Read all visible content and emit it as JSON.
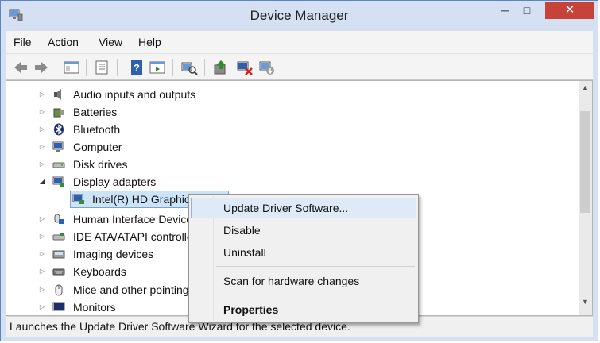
{
  "window": {
    "title": "Device Manager",
    "controls": {
      "minimize": "─",
      "maximize": "□",
      "close": "✕"
    }
  },
  "menubar": {
    "items": [
      "File",
      "Action",
      "View",
      "Help"
    ]
  },
  "toolbar": {
    "icons": [
      "back-arrow-icon",
      "forward-arrow-icon",
      "show-hide-console-tree-icon",
      "properties-icon",
      "help-icon",
      "action-pane-icon",
      "scan-hardware-icon",
      "update-driver-icon",
      "disable-device-icon",
      "uninstall-device-icon"
    ]
  },
  "tree": {
    "items": [
      {
        "label": "Audio inputs and outputs",
        "expander": "▷"
      },
      {
        "label": "Batteries",
        "expander": "▷"
      },
      {
        "label": "Bluetooth",
        "expander": "▷"
      },
      {
        "label": "Computer",
        "expander": "▷"
      },
      {
        "label": "Disk drives",
        "expander": "▷"
      },
      {
        "label": "Display adapters",
        "expander": "◢"
      },
      {
        "label": "Intel(R) HD Graphics",
        "expander": ""
      },
      {
        "label": "Human Interface Devices",
        "expander": "▷"
      },
      {
        "label": "IDE ATA/ATAPI controllers",
        "expander": "▷"
      },
      {
        "label": "Imaging devices",
        "expander": "▷"
      },
      {
        "label": "Keyboards",
        "expander": "▷"
      },
      {
        "label": "Mice and other pointing devices",
        "expander": "▷"
      },
      {
        "label": "Monitors",
        "expander": "▷"
      }
    ]
  },
  "scrollbar": {
    "up": "▲",
    "down": "▼"
  },
  "context_menu": {
    "items": [
      "Update Driver Software...",
      "Disable",
      "Uninstall",
      "Scan for hardware changes",
      "Properties"
    ]
  },
  "statusbar": {
    "text": "Launches the Update Driver Software Wizard for the selected device."
  },
  "colors": {
    "close_button": "#c7433a",
    "selection": "#cce4f7",
    "highlight": "#dfeaf8",
    "titlebar": "#d5e1f2"
  }
}
